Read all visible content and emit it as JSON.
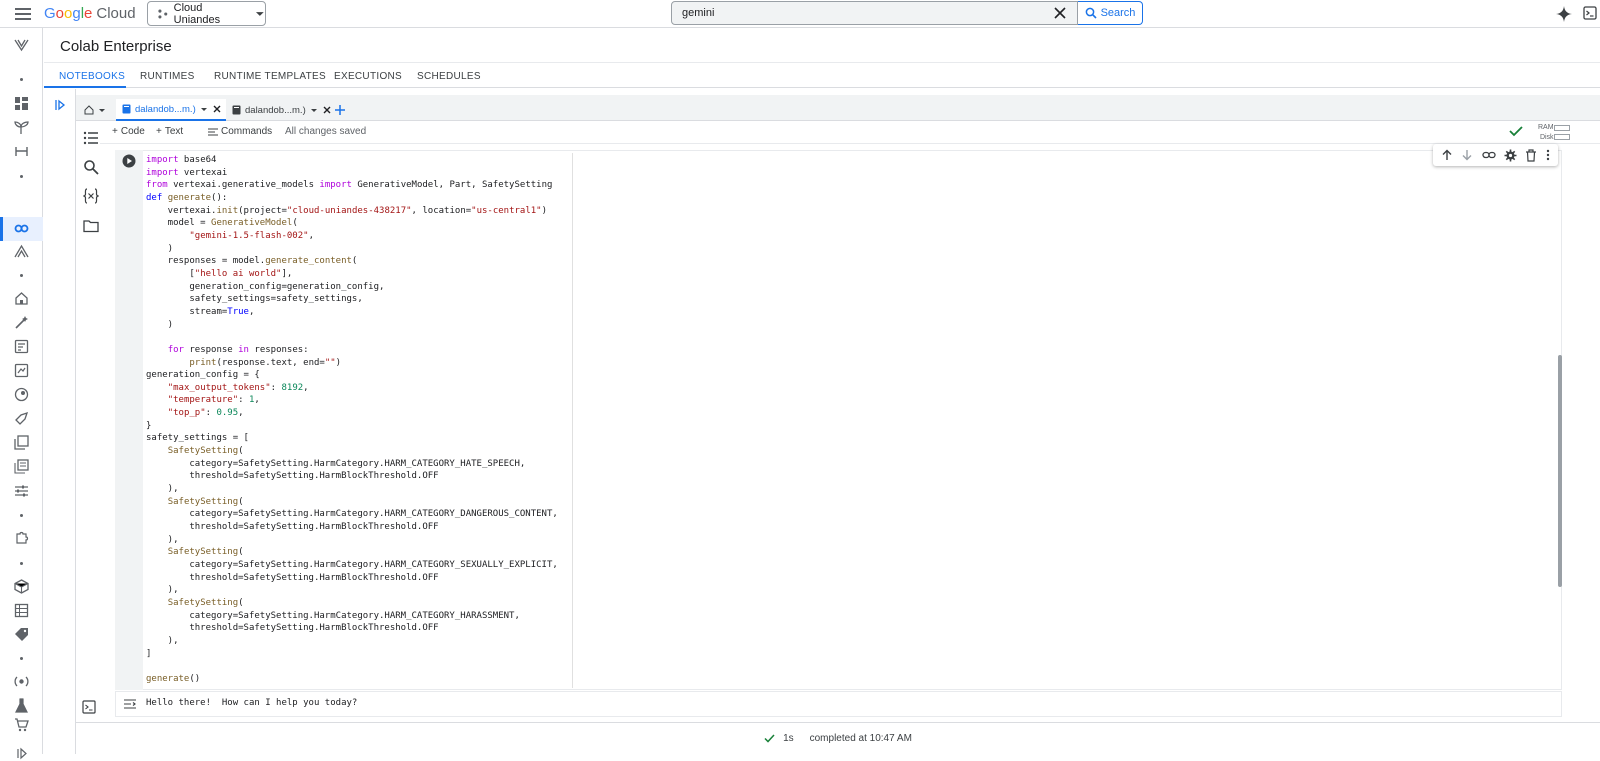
{
  "topbar": {
    "logo_google": "Google",
    "logo_cloud": "Cloud",
    "project": "Cloud Uniandes",
    "search_value": "gemini",
    "search_button": "Search"
  },
  "app": {
    "title": "Colab Enterprise",
    "tabs": [
      "NOTEBOOKS",
      "RUNTIMES",
      "RUNTIME TEMPLATES",
      "EXECUTIONS",
      "SCHEDULES"
    ]
  },
  "notebook_tabs": [
    {
      "label": "dalandob...m.)"
    },
    {
      "label": "dalandob...m.)"
    }
  ],
  "toolbar": {
    "code_label": "Code",
    "text_label": "Text",
    "commands_label": "Commands",
    "status": "All changes saved",
    "ram_label": "RAM",
    "disk_label": "Disk"
  },
  "output": {
    "text": "Hello there!  How can I help you today?"
  },
  "status": {
    "duration": "1s",
    "completed": "completed at 10:47 AM"
  },
  "colors": {
    "accent": "#1a73e8",
    "success": "#188038"
  }
}
